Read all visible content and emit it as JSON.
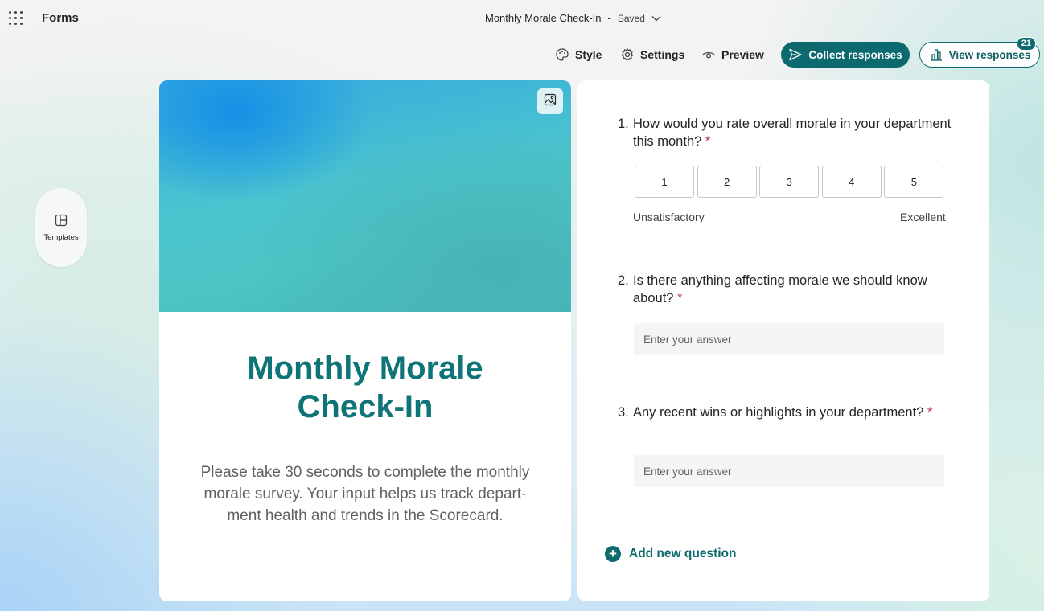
{
  "app": {
    "name": "Forms"
  },
  "header": {
    "doc_title": "Monthly Morale Check-In",
    "separator": "-",
    "save_status": "Saved"
  },
  "toolbar": {
    "style_label": "Style",
    "settings_label": "Settings",
    "preview_label": "Preview",
    "collect_label": "Collect responses",
    "view_label": "View responses",
    "response_count": "21"
  },
  "sidebar": {
    "templates_label": "Templates"
  },
  "form": {
    "title": "Monthly Morale Check-In",
    "description": "Please take 30 seconds to complete the monthly morale survey. Your input helps us track depart-ment health and trends in the Scorecard."
  },
  "questions": [
    {
      "number": "1.",
      "text": "How would you rate overall morale in your department this month?",
      "required": "*",
      "ratings": [
        "1",
        "2",
        "3",
        "4",
        "5"
      ],
      "low_label": "Unsatisfactory",
      "high_label": "Excellent"
    },
    {
      "number": "2.",
      "text": "Is there anything affecting morale we should know about?",
      "required": "*",
      "placeholder": "Enter your answer"
    },
    {
      "number": "3.",
      "text": "Any recent wins or highlights in your department?",
      "required": "*",
      "placeholder": "Enter your answer"
    }
  ],
  "add_question_label": "Add new question",
  "colors": {
    "accent": "#0c6a6e",
    "title": "#0e7477",
    "required": "#c4314b"
  }
}
